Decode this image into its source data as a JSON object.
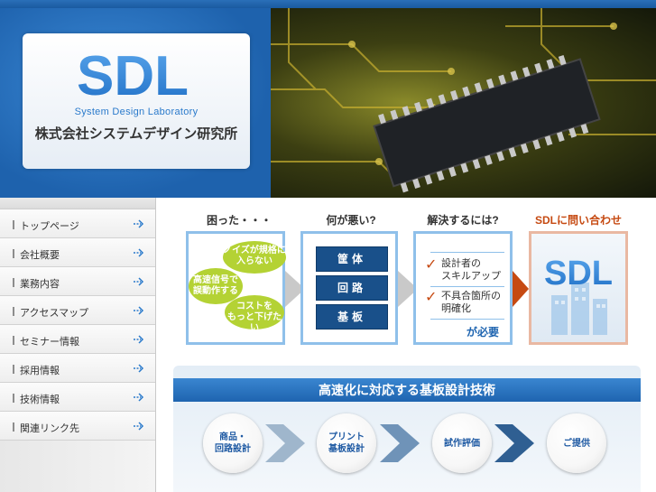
{
  "header": {
    "logo_text": "SDL",
    "logo_subtitle": "System Design Laboratory",
    "company_name": "株式会社システムデザイン研究所"
  },
  "sidebar": {
    "items": [
      {
        "label": "トップページ"
      },
      {
        "label": "会社概要"
      },
      {
        "label": "業務内容"
      },
      {
        "label": "アクセスマップ"
      },
      {
        "label": "セミナー情報"
      },
      {
        "label": "採用情報"
      },
      {
        "label": "技術情報"
      },
      {
        "label": "関連リンク先"
      }
    ]
  },
  "steps": {
    "problem_title": "困った・・・",
    "cause_title": "何が悪い?",
    "solution_title": "解決するには?",
    "contact_title": "SDLに問い合わせ",
    "clouds": {
      "noise_line1": "ノイズが規格に",
      "noise_line2": "入らない",
      "speed_line1": "高速信号で",
      "speed_line2": "誤動作する",
      "cost_line1": "コストを",
      "cost_line2": "もっと下げたい"
    },
    "causes": [
      "筐体",
      "回路",
      "基板"
    ],
    "solutions": [
      {
        "line1": "設計者の",
        "line2": "スキルアップ"
      },
      {
        "line1": "不具合箇所の",
        "line2": "明確化"
      }
    ],
    "solution_footer": "が必要",
    "contact_logo": "SDL"
  },
  "banner": {
    "title": "高速化に対応する基板設計技術",
    "flow": [
      {
        "line1": "商品・",
        "line2": "回路設計"
      },
      {
        "line1": "プリント",
        "line2": "基板設計"
      },
      {
        "line1": "試作評価",
        "line2": ""
      },
      {
        "line1": "ご提供",
        "line2": ""
      }
    ]
  },
  "colors": {
    "accent_blue": "#1e64b0",
    "dark_blue": "#19508a",
    "orange": "#c64a12",
    "cloud_green": "#b4d234"
  }
}
